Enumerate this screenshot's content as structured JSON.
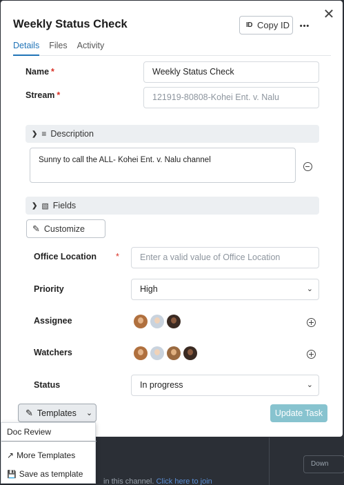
{
  "dialog": {
    "title": "Weekly Status Check",
    "copy_id_label": "Copy ID",
    "more_label": "•••",
    "close_label": "✕"
  },
  "tabs": [
    {
      "label": "Details",
      "active": true
    },
    {
      "label": "Files",
      "active": false
    },
    {
      "label": "Activity",
      "active": false
    }
  ],
  "form": {
    "name": {
      "label": "Name",
      "required_mark": "*",
      "value": "Weekly Status Check"
    },
    "stream": {
      "label": "Stream",
      "required_mark": "*",
      "placeholder": "121919-80808-Kohei Ent. v. Nalu"
    },
    "description_section": {
      "label": "Description"
    },
    "description_text": "Sunny to call the ALL- Kohei Ent. v. Nalu channel",
    "fields_section": {
      "label": "Fields"
    },
    "customize_label": "Customize",
    "office_location": {
      "label": "Office Location",
      "required_mark": "*",
      "placeholder": "Enter a valid value of Office Location"
    },
    "priority": {
      "label": "Priority",
      "value": "High"
    },
    "assignee": {
      "label": "Assignee",
      "avatar_count": 3
    },
    "watchers": {
      "label": "Watchers",
      "avatar_count": 4
    },
    "status": {
      "label": "Status",
      "value": "In progress"
    }
  },
  "footer": {
    "templates_label": "Templates",
    "update_label": "Update Task"
  },
  "templates_menu": {
    "items": [
      "Doc Review",
      "More Templates",
      "Save as template"
    ]
  },
  "background": {
    "channel_text": "in this channel.",
    "link_text": "Click here to join",
    "button_label": "Down"
  },
  "colors": {
    "accent": "#1f73b7",
    "required": "#d93025",
    "update_button": "#87c3cf",
    "section_bar": "#eceff2"
  }
}
